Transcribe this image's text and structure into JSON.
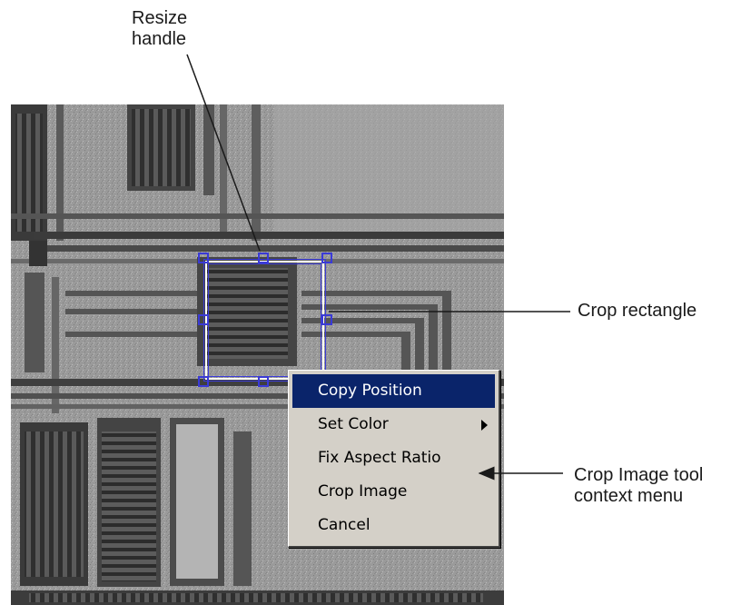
{
  "callouts": {
    "resize_handle": [
      "Resize",
      "handle"
    ],
    "crop_rectangle": "Crop rectangle",
    "context_menu": [
      "Crop Image tool",
      "context  menu"
    ]
  },
  "context_menu": {
    "items": [
      {
        "label": "Copy Position",
        "selected": true
      },
      {
        "label": "Set Color",
        "has_submenu": true
      },
      {
        "label": "Fix Aspect Ratio"
      },
      {
        "label": "Crop Image"
      },
      {
        "label": "Cancel"
      }
    ]
  },
  "colors": {
    "crop_outline": "#3b3bd8",
    "menu_background": "#d4d0c8",
    "menu_highlight": "#0a246a"
  }
}
